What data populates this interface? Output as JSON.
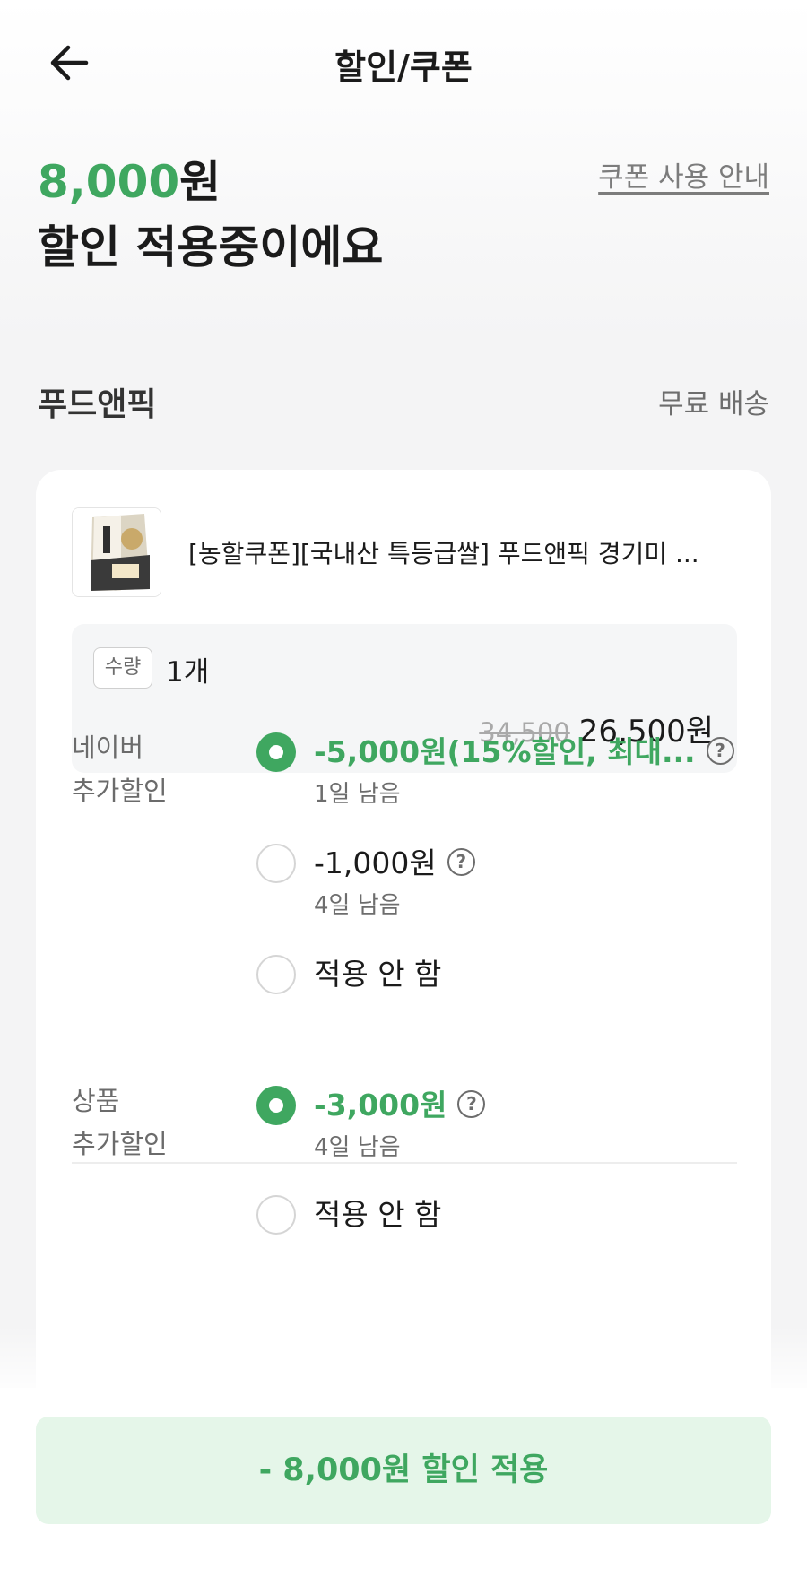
{
  "header": {
    "title": "할인/쿠폰"
  },
  "summary": {
    "amount": "8,000",
    "currency": "원",
    "message": "할인 적용중이에요",
    "guide_link": "쿠폰 사용 안내"
  },
  "seller": {
    "name": "푸드앤픽",
    "shipping": "무료 배송"
  },
  "product": {
    "title": "[농할쿠폰][국내산 특등급쌀] 푸드앤픽 경기미 ...",
    "quantity_badge": "수량",
    "quantity": "1개",
    "original_price": "34,500",
    "final_price": "26,500원"
  },
  "naver_discount": {
    "label_line1": "네이버",
    "label_line2": "추가할인",
    "options": [
      {
        "text": "-5,000원(15%할인, 최대...",
        "sub": "1일 남음",
        "selected": true
      },
      {
        "text": "-1,000원",
        "sub": "4일 남음",
        "selected": false
      },
      {
        "text": "적용 안 함",
        "selected": false
      }
    ]
  },
  "product_discount": {
    "label_line1": "상품",
    "label_line2": "추가할인",
    "options": [
      {
        "text": "-3,000원",
        "sub": "4일 남음",
        "selected": true
      },
      {
        "text": "적용 안 함",
        "selected": false
      }
    ]
  },
  "help_glyph": "?",
  "apply_button": {
    "label": "- 8,000원 할인 적용"
  },
  "colors": {
    "accent": "#3fa760",
    "accent_bg": "#e5f6e9"
  }
}
